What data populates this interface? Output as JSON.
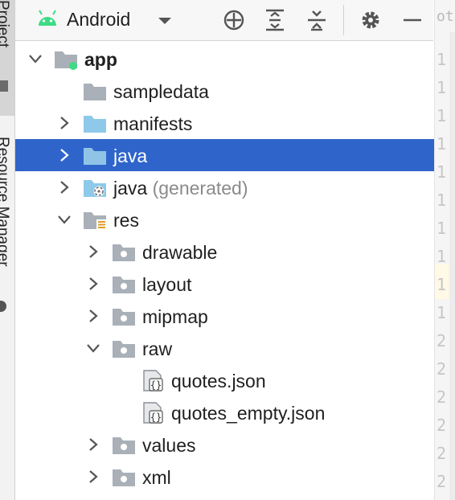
{
  "tool_strip": {
    "project_label": "Project",
    "resource_manager_label": "Resource Manager"
  },
  "toolbar": {
    "view_selector": "Android",
    "buttons": [
      "locate-icon",
      "expand-all-icon",
      "collapse-all-icon",
      "gear-icon",
      "minimize-icon"
    ]
  },
  "editor_edge": {
    "tab_hint": "ot",
    "line_numbers": [
      "1",
      "1",
      "1",
      "1",
      "1",
      "1",
      "1",
      "1",
      "1",
      "1",
      "2",
      "2",
      "2",
      "2",
      "2",
      "2"
    ]
  },
  "tree": {
    "items": [
      {
        "label": "app",
        "level": 0,
        "expanded": true,
        "icon": "module-folder-icon"
      },
      {
        "label": "sampledata",
        "level": 1,
        "icon": "folder-icon"
      },
      {
        "label": "manifests",
        "level": 1,
        "expanded": false,
        "icon": "manifests-folder-icon"
      },
      {
        "label": "java",
        "level": 1,
        "expanded": false,
        "selected": true,
        "icon": "source-folder-icon"
      },
      {
        "label": "java",
        "suffix": "(generated)",
        "level": 1,
        "expanded": false,
        "icon": "generated-folder-icon"
      },
      {
        "label": "res",
        "level": 1,
        "expanded": true,
        "icon": "resource-folder-icon"
      },
      {
        "label": "drawable",
        "level": 2,
        "expanded": false,
        "icon": "package-folder-icon"
      },
      {
        "label": "layout",
        "level": 2,
        "expanded": false,
        "icon": "package-folder-icon"
      },
      {
        "label": "mipmap",
        "level": 2,
        "expanded": false,
        "icon": "package-folder-icon"
      },
      {
        "label": "raw",
        "level": 2,
        "expanded": true,
        "icon": "package-folder-icon"
      },
      {
        "label": "quotes.json",
        "level": 3,
        "icon": "json-file-icon"
      },
      {
        "label": "quotes_empty.json",
        "level": 3,
        "icon": "json-file-icon"
      },
      {
        "label": "values",
        "level": 2,
        "expanded": false,
        "icon": "package-folder-icon"
      },
      {
        "label": "xml",
        "level": 2,
        "expanded": false,
        "icon": "package-folder-icon"
      }
    ]
  },
  "colors": {
    "selection": "#2f65ca",
    "android_green": "#3ddc84",
    "folder_gray": "#a9b0b8",
    "folder_blue": "#8ec9ea"
  }
}
